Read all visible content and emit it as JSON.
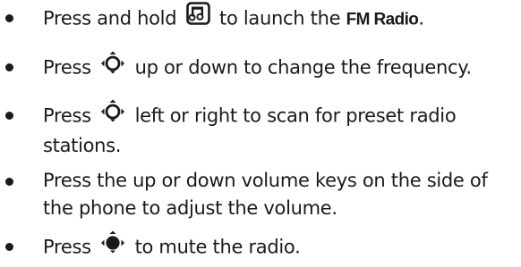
{
  "instructions": [
    {
      "before": "Press and hold",
      "icon": "music-key-icon",
      "after": "to launch the",
      "bold": "FM Radio",
      "end": "."
    },
    {
      "before": "Press",
      "icon": "nav-key-up-icon",
      "after": "up or down to change the frequency."
    },
    {
      "before": "Press",
      "icon": "nav-key-up-icon",
      "after": "left or right to scan for preset radio",
      "line2": "stations."
    },
    {
      "line1": "Press the up or down volume keys on the side of",
      "line2": "the phone to adjust the volume."
    },
    {
      "before": "Press",
      "icon": "nav-key-center-icon",
      "after": "to mute the radio."
    }
  ]
}
